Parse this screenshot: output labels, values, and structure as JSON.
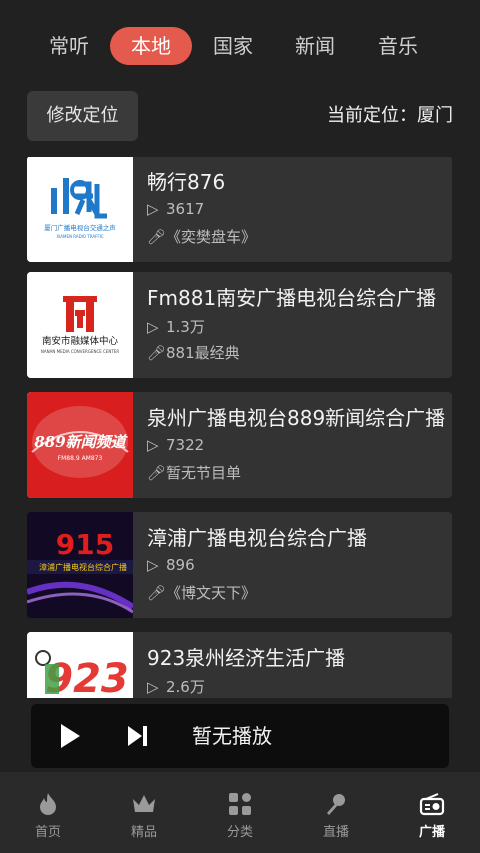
{
  "tabs": [
    "常听",
    "本地",
    "国家",
    "新闻",
    "音乐"
  ],
  "active_tab": "本地",
  "location": {
    "button_label": "修改定位",
    "label": "当前定位：",
    "city": "厦门"
  },
  "stations": [
    {
      "title": "畅行876",
      "plays": "3617",
      "program": "《奕樊盘车》",
      "logo_text": "畅",
      "logo_caption": "厦门广播电视台交通之声"
    },
    {
      "title": "Fm881南安广播电视台综合广播",
      "plays": "1.3万",
      "program": "881最经典",
      "logo_caption": "南安市融媒体中心",
      "logo_caption_en": "NANAN MEDIA CONVERGENCE CENTER"
    },
    {
      "title": "泉州广播电视台889新闻综合广播",
      "plays": "7322",
      "program": "暂无节目单",
      "logo_text": "889新闻频道",
      "logo_sub": "FM88.9 AM873"
    },
    {
      "title": "漳浦广播电视台综合广播",
      "plays": "896",
      "program": "《博文天下》",
      "logo_text": "915",
      "logo_caption": "漳浦广播电视台综合广播"
    },
    {
      "title": "923泉州经济生活广播",
      "plays": "2.6万",
      "program": "",
      "logo_text": "923"
    }
  ],
  "player": {
    "status": "暂无播放"
  },
  "nav": [
    {
      "label": "首页",
      "icon": "flame-icon"
    },
    {
      "label": "精品",
      "icon": "crown-icon"
    },
    {
      "label": "分类",
      "icon": "grid-icon"
    },
    {
      "label": "直播",
      "icon": "microphone-icon"
    },
    {
      "label": "广播",
      "icon": "radio-icon"
    }
  ],
  "active_nav": "广播",
  "colors": {
    "accent": "#e45a4c",
    "background": "#212121",
    "card": "#333333",
    "player": "#0d0d0d"
  }
}
